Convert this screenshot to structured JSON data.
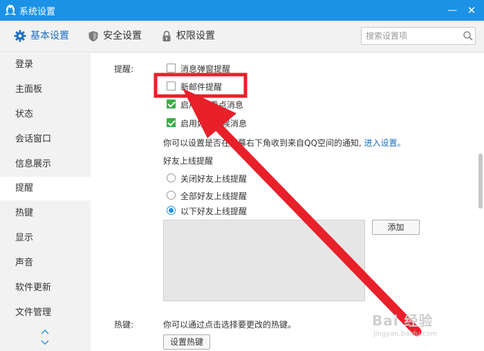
{
  "window": {
    "title": "系统设置",
    "minimize_glyph": "—",
    "close_glyph": "✕"
  },
  "tabs": [
    {
      "label": "基本设置",
      "icon": "gear-icon",
      "active": true
    },
    {
      "label": "安全设置",
      "icon": "shield-icon",
      "active": false
    },
    {
      "label": "权限设置",
      "icon": "lock-icon",
      "active": false
    }
  ],
  "search": {
    "placeholder": "搜索设置项",
    "value": ""
  },
  "sidebar": {
    "items": [
      {
        "label": "登录"
      },
      {
        "label": "主面板"
      },
      {
        "label": "状态"
      },
      {
        "label": "会话窗口"
      },
      {
        "label": "信息展示"
      },
      {
        "label": "提醒",
        "active": true
      },
      {
        "label": "热键"
      },
      {
        "label": "显示"
      },
      {
        "label": "声音"
      },
      {
        "label": "软件更新"
      },
      {
        "label": "文件管理"
      }
    ]
  },
  "reminders": {
    "section_label": "提醒:",
    "options": [
      {
        "label": "消息弹窗提醒",
        "checked": false
      },
      {
        "label": "新邮件提醒",
        "checked": false
      },
      {
        "label": "启用QQ看点消息",
        "checked": true
      },
      {
        "label": "启用好友问候消息",
        "checked": true
      }
    ],
    "notice_text": "你可以设置是否在屏幕右下角收到来自QQ空间的通知,",
    "notice_link": "进入设置。",
    "friend_online_title": "好友上线提醒",
    "friend_online_options": [
      {
        "label": "关闭好友上线提醒",
        "selected": false
      },
      {
        "label": "全部好友上线提醒",
        "selected": false
      },
      {
        "label": "以下好友上线提醒",
        "selected": true
      }
    ],
    "add_button": "添加"
  },
  "hotkeys": {
    "section_label": "热键:",
    "description": "你可以通过点击选择要更改的热键。",
    "set_button": "设置热键"
  },
  "annotation": {
    "highlight_color": "#e8202a",
    "arrow_color": "#e8202a"
  },
  "watermark": {
    "brand": "Bai 经验",
    "url": "jingyan.baidu.com"
  },
  "colors": {
    "titlebar": "#1c92e6",
    "accent": "#1a6fc0",
    "checked": "#3cae47"
  }
}
